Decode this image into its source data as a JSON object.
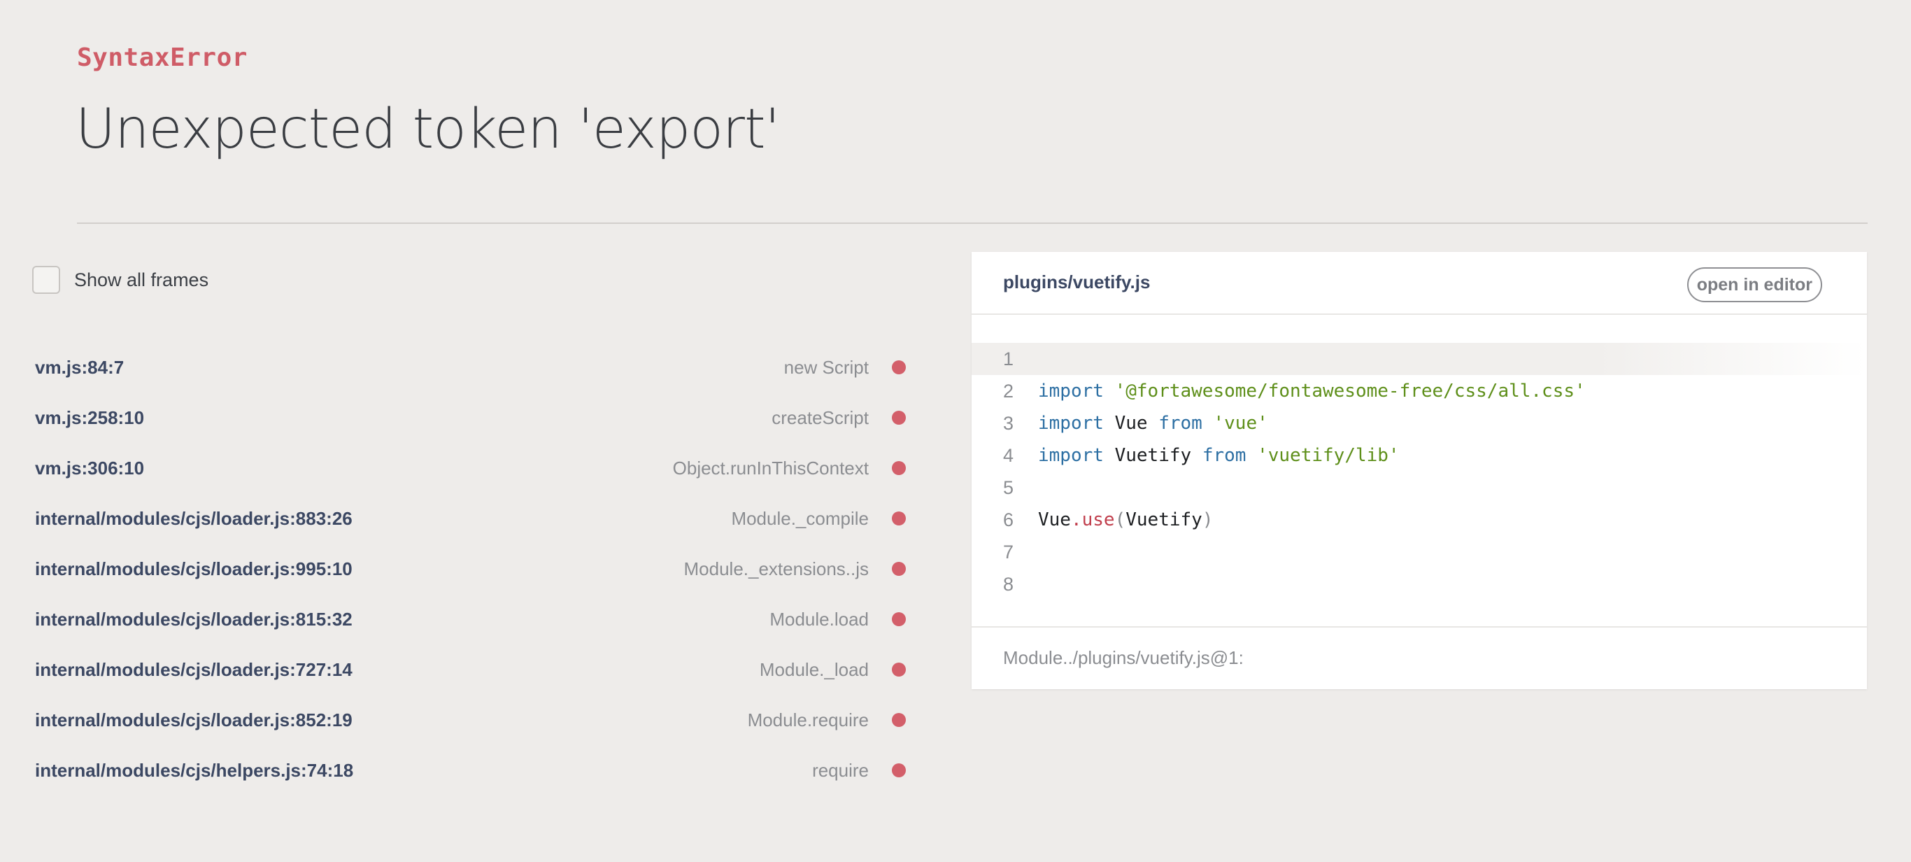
{
  "error": {
    "type": "SyntaxError",
    "message": "Unexpected token 'export'"
  },
  "frames_toggle": {
    "label": "Show all frames",
    "checked": false
  },
  "frames": [
    {
      "location": "vm.js:84:7",
      "function": "new Script"
    },
    {
      "location": "vm.js:258:10",
      "function": "createScript"
    },
    {
      "location": "vm.js:306:10",
      "function": "Object.runInThisContext"
    },
    {
      "location": "internal/modules/cjs/loader.js:883:26",
      "function": "Module._compile"
    },
    {
      "location": "internal/modules/cjs/loader.js:995:10",
      "function": "Module._extensions..js"
    },
    {
      "location": "internal/modules/cjs/loader.js:815:32",
      "function": "Module.load"
    },
    {
      "location": "internal/modules/cjs/loader.js:727:14",
      "function": "Module._load"
    },
    {
      "location": "internal/modules/cjs/loader.js:852:19",
      "function": "Module.require"
    },
    {
      "location": "internal/modules/cjs/helpers.js:74:18",
      "function": "require"
    }
  ],
  "code_panel": {
    "file_path": "plugins/vuetify.js",
    "open_editor_label": "open in editor",
    "highlighted_line": 1,
    "lines": [
      {
        "num": "1",
        "tokens": []
      },
      {
        "num": "2",
        "tokens": [
          {
            "t": "kw",
            "v": "import"
          },
          {
            "t": "plain",
            "v": " "
          },
          {
            "t": "str",
            "v": "'@fortawesome/fontawesome-free/css/all.css'"
          }
        ]
      },
      {
        "num": "3",
        "tokens": [
          {
            "t": "kw",
            "v": "import"
          },
          {
            "t": "plain",
            "v": " Vue "
          },
          {
            "t": "kw",
            "v": "from"
          },
          {
            "t": "plain",
            "v": " "
          },
          {
            "t": "str",
            "v": "'vue'"
          }
        ]
      },
      {
        "num": "4",
        "tokens": [
          {
            "t": "kw",
            "v": "import"
          },
          {
            "t": "plain",
            "v": " Vuetify "
          },
          {
            "t": "kw",
            "v": "from"
          },
          {
            "t": "plain",
            "v": " "
          },
          {
            "t": "str",
            "v": "'vuetify/lib'"
          }
        ]
      },
      {
        "num": "5",
        "tokens": []
      },
      {
        "num": "6",
        "tokens": [
          {
            "t": "plain",
            "v": "Vue"
          },
          {
            "t": "punc",
            "v": "."
          },
          {
            "t": "punc",
            "v": "use"
          },
          {
            "t": "paren",
            "v": "("
          },
          {
            "t": "plain",
            "v": "Vuetify"
          },
          {
            "t": "paren",
            "v": ")"
          }
        ]
      },
      {
        "num": "7",
        "tokens": []
      },
      {
        "num": "8",
        "tokens": []
      }
    ],
    "footer": "Module../plugins/vuetify.js@1:"
  },
  "colors": {
    "background": "#eeecea",
    "error_type": "#cf5c67",
    "frame_dot": "#d35f6a",
    "frame_location": "#3c4863",
    "keyword": "#2d6fa3",
    "string": "#5e8f1a"
  }
}
